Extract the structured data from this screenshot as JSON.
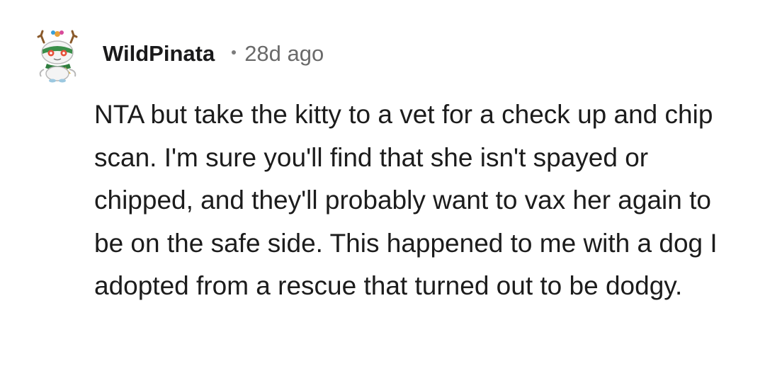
{
  "comment": {
    "author": "WildPinata",
    "separator": "•",
    "age": "28d ago",
    "avatar_icon": "snoo-avatar-icon",
    "body": "NTA but take the kitty to a vet for a check up and chip scan. I'm sure you'll find that she isn't spayed or chipped, and they'll probably want to vax her again to be on the safe side. This happened to me with a dog I adopted from a rescue that turned out to be dodgy."
  },
  "colors": {
    "text": "#1c1c1c",
    "meta": "#6a6a6a",
    "avatar_green": "#3a8f4a",
    "avatar_accent": "#e8503a"
  }
}
